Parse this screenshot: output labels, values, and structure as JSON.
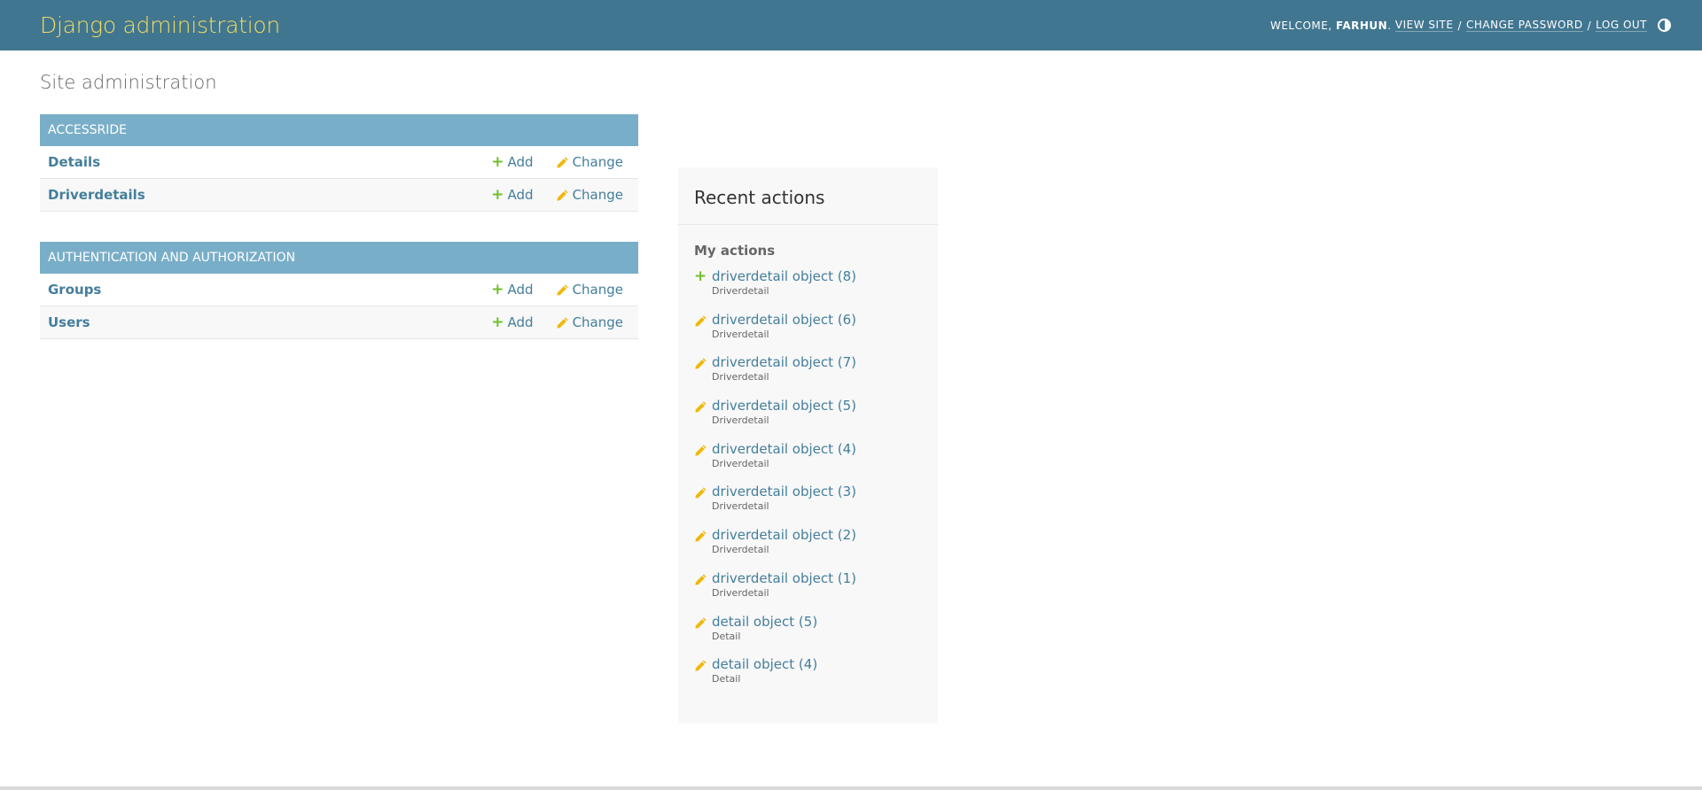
{
  "header": {
    "brand": "Django administration",
    "welcome": "WELCOME,",
    "username": "FARHUN",
    "view_site": "VIEW SITE",
    "change_password": "CHANGE PASSWORD",
    "log_out": "LOG OUT",
    "separator": "/",
    "period": "."
  },
  "page_title": "Site administration",
  "apps": [
    {
      "caption": "ACCESSRIDE",
      "models": [
        {
          "name": "Details",
          "add": "Add",
          "change": "Change"
        },
        {
          "name": "Driverdetails",
          "add": "Add",
          "change": "Change"
        }
      ]
    },
    {
      "caption": "AUTHENTICATION AND AUTHORIZATION",
      "models": [
        {
          "name": "Groups",
          "add": "Add",
          "change": "Change"
        },
        {
          "name": "Users",
          "add": "Add",
          "change": "Change"
        }
      ]
    }
  ],
  "recent": {
    "title": "Recent actions",
    "subtitle": "My actions",
    "items": [
      {
        "icon": "plus-icon",
        "label": "driverdetail object (8)",
        "type": "Driverdetail"
      },
      {
        "icon": "pencil-icon",
        "label": "driverdetail object (6)",
        "type": "Driverdetail"
      },
      {
        "icon": "pencil-icon",
        "label": "driverdetail object (7)",
        "type": "Driverdetail"
      },
      {
        "icon": "pencil-icon",
        "label": "driverdetail object (5)",
        "type": "Driverdetail"
      },
      {
        "icon": "pencil-icon",
        "label": "driverdetail object (4)",
        "type": "Driverdetail"
      },
      {
        "icon": "pencil-icon",
        "label": "driverdetail object (3)",
        "type": "Driverdetail"
      },
      {
        "icon": "pencil-icon",
        "label": "driverdetail object (2)",
        "type": "Driverdetail"
      },
      {
        "icon": "pencil-icon",
        "label": "driverdetail object (1)",
        "type": "Driverdetail"
      },
      {
        "icon": "pencil-icon",
        "label": "detail object (5)",
        "type": "Detail"
      },
      {
        "icon": "pencil-icon",
        "label": "detail object (4)",
        "type": "Detail"
      }
    ]
  },
  "colors": {
    "header_bg": "#417690",
    "brand": "#f5dd5d",
    "caption_bg": "#79aec8",
    "link": "#447e9b",
    "add_green": "#70bf2b",
    "change_yellow": "#efb80b"
  }
}
